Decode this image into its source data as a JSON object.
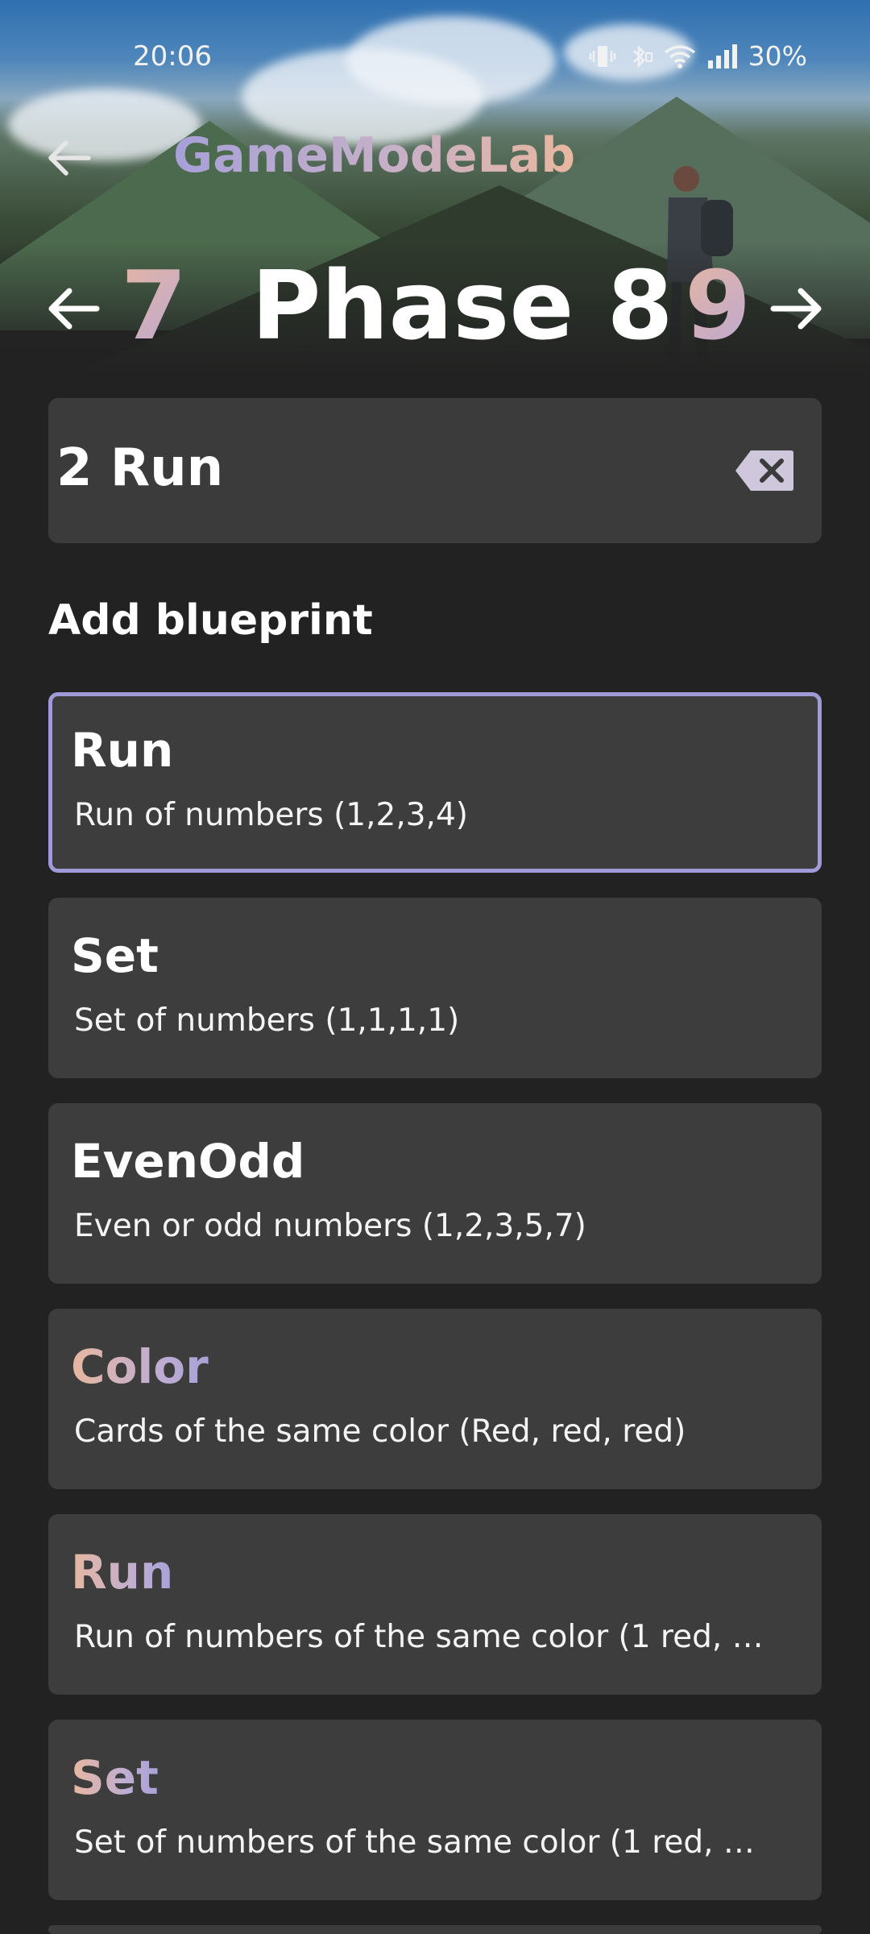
{
  "status_bar": {
    "time": "20:06",
    "battery": "30%",
    "icons": [
      "vibrate-icon",
      "bluetooth-icon",
      "wifi-icon",
      "signal-icon"
    ]
  },
  "app_bar": {
    "title": "GameModeLab",
    "back_icon": "arrow-left-icon"
  },
  "phase": {
    "prev": "7",
    "title": "Phase 8",
    "next": "9"
  },
  "phase_input": {
    "value": "2 Run",
    "clear_icon": "backspace-icon"
  },
  "add_blueprint_label": "Add blueprint",
  "blueprints": [
    {
      "name": "Run",
      "desc": "Run of numbers (1,2,3,4)",
      "selected": true,
      "colored": false
    },
    {
      "name": "Set",
      "desc": "Set of numbers (1,1,1,1)",
      "selected": false,
      "colored": false
    },
    {
      "name": "EvenOdd",
      "desc": "Even or odd numbers (1,2,3,5,7)",
      "selected": false,
      "colored": false
    },
    {
      "name": "Color",
      "desc": "Cards of the same color (Red, red, red)",
      "selected": false,
      "colored": true
    },
    {
      "name": "Run",
      "desc": "Run of numbers of the same color (1 red, …",
      "selected": false,
      "colored": true
    },
    {
      "name": "Set",
      "desc": "Set of numbers of the same color (1 red, …",
      "selected": false,
      "colored": true
    }
  ],
  "colors": {
    "background": "#222222",
    "card": "#3d3d3d",
    "accent": "#a09ad8",
    "gradient_start": "#e8b7a0",
    "gradient_end": "#a8a2d9"
  }
}
